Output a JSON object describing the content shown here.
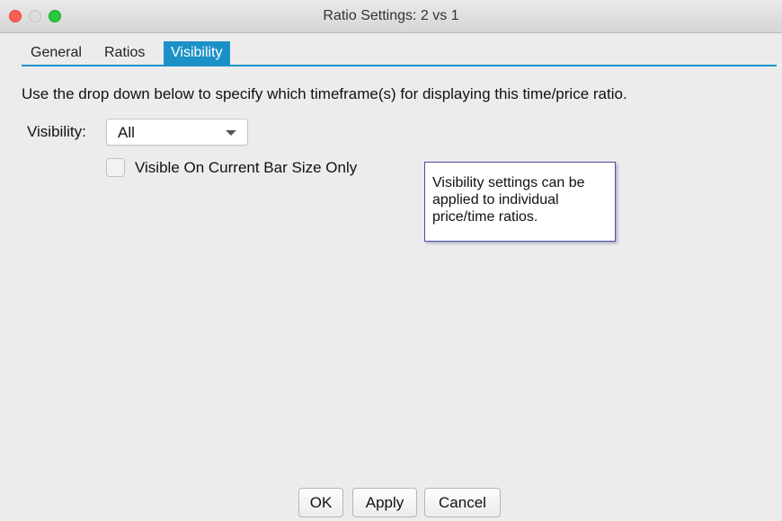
{
  "window": {
    "title": "Ratio Settings: 2 vs 1"
  },
  "tabs": [
    {
      "label": "General",
      "active": false
    },
    {
      "label": "Ratios",
      "active": false
    },
    {
      "label": "Visibility",
      "active": true
    }
  ],
  "content": {
    "description": "Use the drop down below to specify which timeframe(s) for displaying this time/price ratio.",
    "visibility_label": "Visibility:",
    "visibility_select": {
      "value": "All"
    },
    "checkbox": {
      "label": "Visible On Current Bar Size Only",
      "checked": false
    },
    "tooltip_lines": [
      "Visibility settings can be",
      "applied to individual",
      "price/time ratios."
    ]
  },
  "buttons": {
    "ok": "OK",
    "apply": "Apply",
    "cancel": "Cancel"
  },
  "colors": {
    "accent": "#1c91c8",
    "close": "#fd5f57",
    "maximize": "#28c840"
  },
  "icons": [
    "close-window-icon",
    "minimize-window-icon",
    "maximize-window-icon",
    "dropdown-arrow-icon"
  ]
}
